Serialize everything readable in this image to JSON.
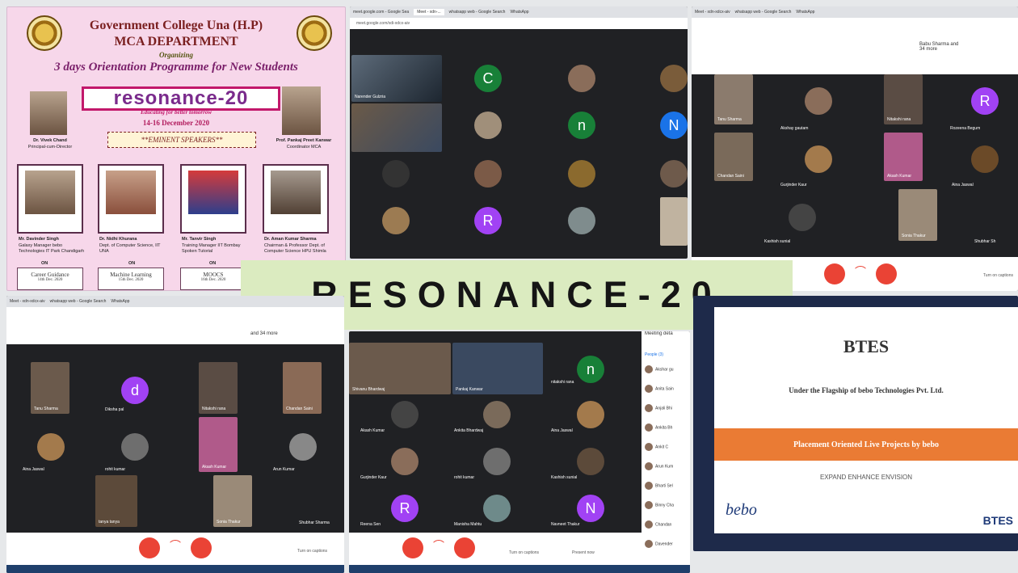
{
  "poster": {
    "college": "Government College Una (H.P)",
    "dept": "MCA DEPARTMENT",
    "organizing": "Organizing",
    "programme": "3 days Orientation Programme for New Students",
    "event_logo": "resonance-20",
    "tagline": "Educating for better tomorrow",
    "dates": "14-16 December 2020",
    "eminent": "**EMINENT SPEAKERS**",
    "principal": {
      "name": "Dr. Vivek Chand",
      "role": "Principal-cum-Director"
    },
    "coordinator": {
      "name": "Prof. Pankaj Preet Kanwar",
      "role": "Coordinator MCA"
    },
    "speakers": [
      {
        "name": "Mr. Davinder Singh",
        "role": "Galaxy Manager bebo Technologies IT Park Chandigarh",
        "on": "ON",
        "topic": "Career Guidance",
        "date": "14th Dec. 2020"
      },
      {
        "name": "Dr. Nidhi Khurana",
        "role": "Dept. of Computer Science, IIT UNA",
        "on": "ON",
        "topic": "Machine Learning",
        "date": "15th Dec. 2020"
      },
      {
        "name": "Mr. Tanvir Singh",
        "role": "Training Manager IIT Bombay Spoken Tutorial",
        "on": "ON",
        "topic": "MOOCS",
        "date": "16th Dec. 2020"
      },
      {
        "name": "Dr. Aman Kumar Sharma",
        "role": "Chairman & Professor Dept. of Computer Science HPU Shimla",
        "on": "ON",
        "topic": "",
        "date": ""
      }
    ]
  },
  "banner": {
    "text": "RESONANCE-20"
  },
  "meet1": {
    "tabs": [
      "meet.google.com - Google Sea",
      "Meet - xdn-...",
      "whatsapp web - Google Search",
      "WhatsApp"
    ],
    "url": "meet.google.com/xdi-xdcx-aiv",
    "people": [
      {
        "label": "Narender Gulzria",
        "letter": "",
        "color": "#5f6368"
      },
      {
        "label": "",
        "letter": "C",
        "color": "#188038"
      },
      {
        "label": "",
        "letter": "",
        "color": "#8a6d5a"
      },
      {
        "label": "",
        "letter": "",
        "color": "#7a5c3a"
      },
      {
        "label": "",
        "letter": "",
        "color": "#6b4f3f"
      },
      {
        "label": "",
        "letter": "",
        "color": "#a08f7a"
      },
      {
        "label": "",
        "letter": "n",
        "color": "#188038"
      },
      {
        "label": "",
        "letter": "N",
        "color": "#1a73e8"
      },
      {
        "label": "",
        "letter": "",
        "color": "#333333"
      },
      {
        "label": "",
        "letter": "",
        "color": "#7b5a47"
      },
      {
        "label": "",
        "letter": "",
        "color": "#8b6a2e"
      },
      {
        "label": "",
        "letter": "",
        "color": "#6e5a4b"
      },
      {
        "label": "",
        "letter": "",
        "color": "#9c7b52"
      },
      {
        "label": "",
        "letter": "R",
        "color": "#a142f4"
      },
      {
        "label": "",
        "letter": "",
        "color": "#7f8c8d"
      },
      {
        "label": "",
        "letter": "",
        "color": "#c0b3a0"
      }
    ]
  },
  "meet2": {
    "header": "Babu Sharma and 34 more",
    "people": [
      "Tanu Sharma",
      "Akshay gautam",
      "Nitakshi rana",
      "Rozeena Begum",
      "Chandan Saini",
      "Gurjinder Kaur",
      "Akash Kumar",
      "Aina Jaswal",
      "Kashish sunial",
      "Sonia Thakur",
      "Shubhar Sh"
    ],
    "letter_R": "R",
    "captions": "Turn on captions"
  },
  "meet3": {
    "header": "and 34 more",
    "people": [
      "Tanu Sharma",
      "Diksha pal",
      "Nitakshi rana",
      "Chandan Saini",
      "Aina Jaswal",
      "rohit kumar",
      "Akash Kumar",
      "Arun Kumar",
      "tanya tanya",
      "Sonia Thakur",
      "Shubhar Sharma"
    ],
    "letter_d": "d",
    "captions": "Turn on captions"
  },
  "meet4": {
    "meeting_details": "Meeting deta",
    "people_tab": "People (3)",
    "people": [
      "Shivanu Bhardwaj",
      "Pankaj Kanwar",
      "nitakshi rana",
      "Akash Kumar",
      "Ankita Bhardwaj",
      "Aina Jaswal",
      "Gurjinder Kaur",
      "rohit kumar",
      "Kashish sunial",
      "Reena Sen",
      "Manisha Mahtu",
      "Navneet Thakur"
    ],
    "sidebar": [
      "Akshar gu",
      "Anita Sain",
      "Anjali Bhi",
      "Ankita Bh",
      "Ankit C",
      "Arun Kum",
      "Bharti Sel",
      "Binny Cha",
      "Chandan",
      "Davender"
    ],
    "captions": "Turn on captions",
    "present": "Present now"
  },
  "btes": {
    "title": "BTES",
    "subtitle": "Under the Flagship of bebo Technologies Pvt. Ltd.",
    "band": "Placement Oriented Live Projects by bebo",
    "motto": "EXPAND ENHANCE ENVISION",
    "logo_left": "bebo",
    "logo_right": "BTES"
  }
}
